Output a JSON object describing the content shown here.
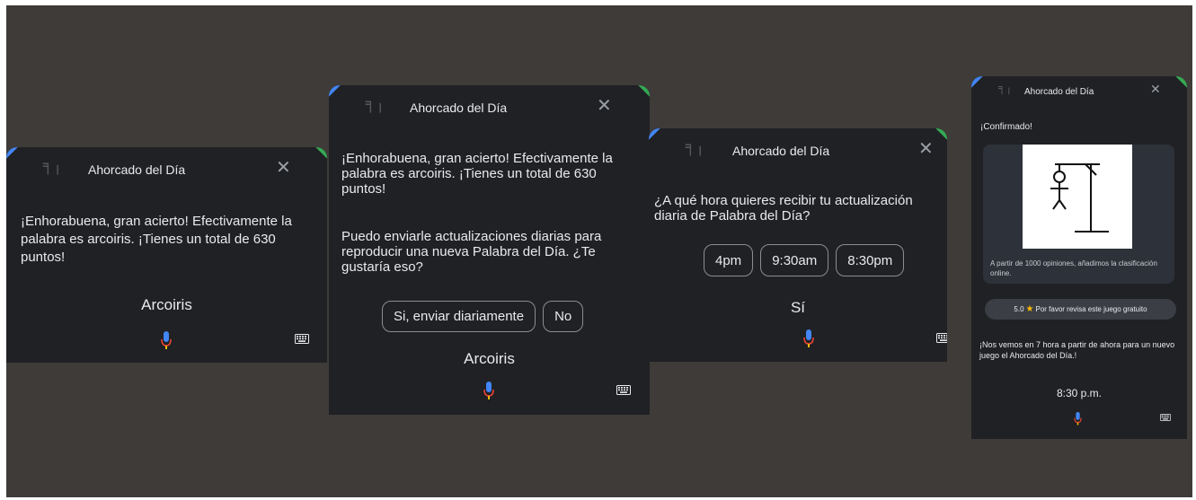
{
  "app": {
    "title": "Ahorcado del Día",
    "logo_glyph": "╕╷"
  },
  "panels": [
    {
      "message": "¡Enhorabuena, gran acierto! Efectivamente la palabra es arcoiris. ¡Tienes un total de 630 puntos!",
      "query": "Arcoiris"
    },
    {
      "message": "¡Enhorabuena, gran acierto! Efectivamente la palabra es arcoiris. ¡Tienes un total de 630 puntos!",
      "message2": "Puedo enviarle actualizaciones diarias para reproducir una nueva Palabra del Día. ¿Te gustaría eso?",
      "chips": [
        "Si, enviar diariamente",
        "No"
      ],
      "query": "Arcoiris"
    },
    {
      "message": "¿A qué hora quieres recibir tu actualización diaria de Palabra del Día?",
      "chips": [
        "4pm",
        "9:30am",
        "8:30pm"
      ],
      "query": "Sí"
    },
    {
      "confirm": "¡Confirmado!",
      "card_text": "A partir de 1000 opiniones, añadimos la clasificación online.",
      "rating_value": "5.0",
      "rating_text": "Por favor revisa este juego gratuito",
      "footer": "¡Nos vemos en 7 hora a partir de ahora para un nuevo juego el Ahorcado del Día.!",
      "query": "8:30 p.m."
    }
  ],
  "icons": {
    "close": "close-icon",
    "mic": "mic-icon",
    "keyboard": "keyboard-icon",
    "star": "star-icon"
  },
  "colors": {
    "background": "#3e3b39",
    "panel": "#202124",
    "text": "#e8eaed",
    "mic_blue": "#4285f4",
    "mic_red": "#ea4335",
    "mic_yellow": "#fbbc04",
    "star": "#fbbc04"
  }
}
